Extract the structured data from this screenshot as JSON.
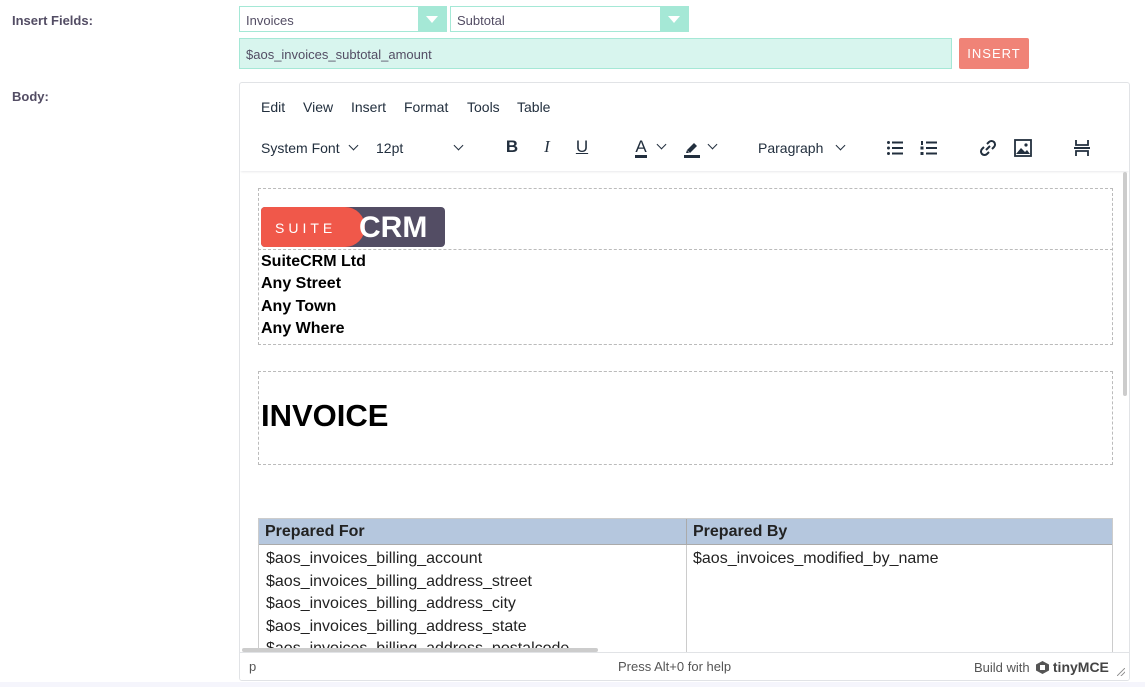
{
  "labels": {
    "insert_fields": "Insert Fields:",
    "body": "Body:"
  },
  "insert_fields": {
    "module_select": "Invoices",
    "field_select": "Subtotal",
    "variable_value": "$aos_invoices_subtotal_amount",
    "insert_button": "INSERT"
  },
  "editor": {
    "menu": [
      "Edit",
      "View",
      "Insert",
      "Format",
      "Tools",
      "Table"
    ],
    "toolbar": {
      "font_family": "System Font",
      "font_size": "12pt",
      "block_format": "Paragraph",
      "bold": "B",
      "italic": "I",
      "underline": "U",
      "text_color": "A"
    },
    "content": {
      "logo_suite": "SUITE",
      "logo_crm": "CRM",
      "company_lines": [
        "SuiteCRM Ltd",
        "Any Street",
        "Any Town",
        "Any Where"
      ],
      "title": "INVOICE",
      "table": {
        "headers": [
          "Prepared For",
          "Prepared By"
        ],
        "col1": [
          "$aos_invoices_billing_account",
          "$aos_invoices_billing_address_street",
          "$aos_invoices_billing_address_city",
          "$aos_invoices_billing_address_state",
          "$aos_invoices_billing_address_postalcode"
        ],
        "col2": [
          "$aos_invoices_modified_by_name"
        ]
      }
    },
    "statusbar": {
      "path": "p",
      "help": "Press Alt+0 for help",
      "brand": "Build with",
      "brand_name": "tinyMCE"
    }
  },
  "colors": {
    "accent": "#a5e8d6",
    "insert_button": "#f08377",
    "table_header": "#b5c7de"
  }
}
